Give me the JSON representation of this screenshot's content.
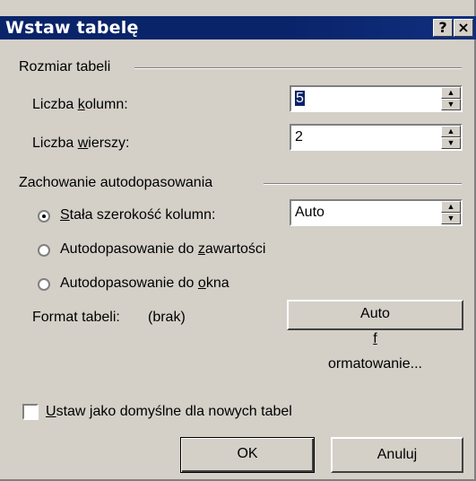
{
  "dialog": {
    "title": "Wstaw tabelę",
    "help_label": "?",
    "close_label": "×"
  },
  "table_size": {
    "group_label": "Rozmiar tabeli",
    "columns_label_prefix": "Liczba ",
    "columns_label_underlined": "k",
    "columns_label_rest": "olumn:",
    "columns_value": "5",
    "rows_label_prefix": "Liczba ",
    "rows_label_underlined": "w",
    "rows_label_rest": "ierszy:",
    "rows_value": "2"
  },
  "autofit": {
    "group_label": "Zachowanie autodopasowania",
    "fixed_prefix": "",
    "fixed_underlined": "S",
    "fixed_rest": "tała szerokość kolumn:",
    "fixed_value": "Auto",
    "fixed_selected": true,
    "contents_prefix": "Autodopasowanie do ",
    "contents_underlined": "z",
    "contents_rest": "awartości",
    "window_prefix": "Autodopasowanie do ",
    "window_underlined": "o",
    "window_rest": "kna"
  },
  "format": {
    "label": "Format tabeli:",
    "value": "(brak)",
    "button_prefix": "Auto",
    "button_underlined": "f",
    "button_rest": "ormatowanie..."
  },
  "default_checkbox": {
    "prefix": "",
    "underlined": "U",
    "rest": "staw jako domyślne dla nowych tabel",
    "checked": false
  },
  "buttons": {
    "ok": "OK",
    "cancel": "Anuluj"
  }
}
